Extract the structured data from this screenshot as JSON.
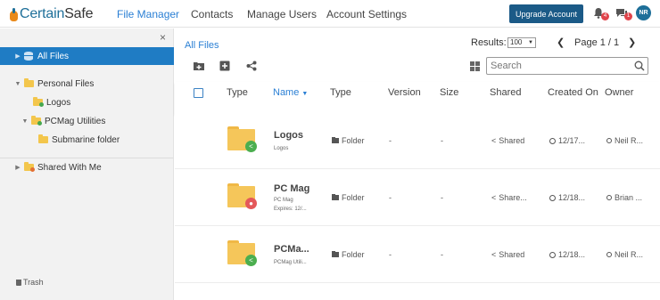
{
  "brand": {
    "name_a": "Certain",
    "name_b": "Safe"
  },
  "nav": {
    "file_manager": "File Manager",
    "contacts": "Contacts",
    "manage_users": "Manage Users",
    "account_settings": "Account Settings"
  },
  "header": {
    "upgrade_label": "Upgrade Account",
    "notif_badge": "4",
    "msg_badge": "1",
    "avatar_initials": "NR"
  },
  "sidebar": {
    "close": "×",
    "items": [
      {
        "label": "All Files"
      },
      {
        "label": "Personal Files"
      },
      {
        "label": "Logos"
      },
      {
        "label": "PCMag Utilities"
      },
      {
        "label": "Submarine folder"
      },
      {
        "label": "Shared With Me"
      }
    ],
    "trash_label": "Trash"
  },
  "main": {
    "breadcrumb": "All Files",
    "results_label": "Results:",
    "results_value": "100",
    "page_label": "Page 1 / 1",
    "search_placeholder": "Search",
    "columns": {
      "type": "Type",
      "name": "Name",
      "type2": "Type",
      "version": "Version",
      "size": "Size",
      "shared": "Shared",
      "created": "Created On",
      "owner": "Owner"
    },
    "rows": [
      {
        "name": "Logos",
        "sub": "Logos",
        "sub2": "",
        "kind": "Folder",
        "version": "-",
        "size": "-",
        "shared": "Shared",
        "created": "12/17...",
        "owner": "Neil R..."
      },
      {
        "name": "PC Mag",
        "sub": "PC Mag",
        "sub2": "Expires: 12/...",
        "kind": "Folder",
        "version": "-",
        "size": "-",
        "shared": "Share...",
        "created": "12/18...",
        "owner": "Brian ..."
      },
      {
        "name": "PCMa...",
        "sub": "PCMag Utili...",
        "sub2": "",
        "kind": "Folder",
        "version": "-",
        "size": "-",
        "shared": "Shared",
        "created": "12/18...",
        "owner": "Neil R..."
      }
    ]
  }
}
